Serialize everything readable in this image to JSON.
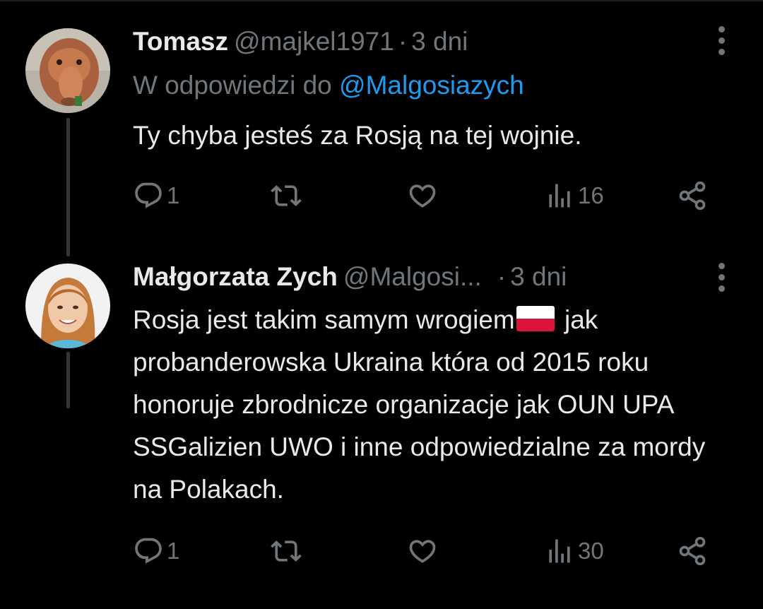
{
  "tweets": [
    {
      "author_name": "Tomasz",
      "author_handle": "@majkel1971",
      "time": "3 dni",
      "replying_prefix": "W odpowiedzi do",
      "replying_to": "@Malgosiazych",
      "text": "Ty chyba jesteś za Rosją na tej wojnie.",
      "replies": "1",
      "views": "16"
    },
    {
      "author_name": "Małgorzata Zych",
      "author_handle": "@Malgosi...",
      "time": "3 dni",
      "text_part1": "Rosja jest takim samym wrogiem",
      "text_part2": " jak probanderowska Ukraina która od 2015 roku honoruje zbrodnicze organizacje jak OUN UPA SSGalizien UWO i inne odpowiedzialne za mordy na Polakach.",
      "replies": "1",
      "views": "30"
    }
  ],
  "colors": {
    "background": "#000000",
    "text": "#e7e9ea",
    "muted": "#71767b",
    "link": "#1d9bf0",
    "thread_line": "#333639"
  },
  "icons": [
    "reply-icon",
    "retweet-icon",
    "like-icon",
    "views-icon",
    "share-icon",
    "more-icon",
    "poland-flag-icon"
  ]
}
